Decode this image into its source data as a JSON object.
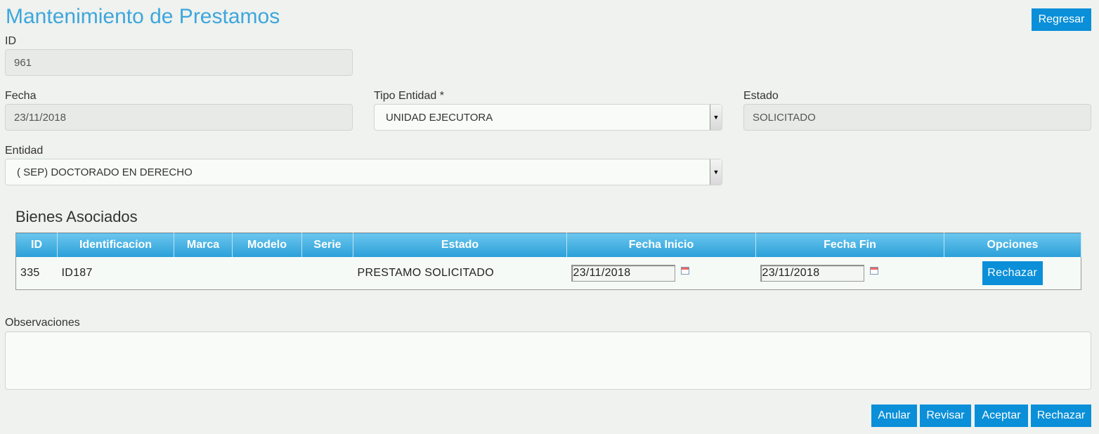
{
  "header": {
    "title": "Mantenimiento de Prestamos",
    "back_button": "Regresar"
  },
  "form": {
    "id": {
      "label": "ID",
      "value": "961"
    },
    "fecha": {
      "label": "Fecha",
      "value": "23/11/2018"
    },
    "tipo_entidad": {
      "label": "Tipo Entidad *",
      "value": "UNIDAD EJECUTORA"
    },
    "estado": {
      "label": "Estado",
      "value": "SOLICITADO"
    },
    "entidad": {
      "label": "Entidad",
      "value": "( SEP) DOCTORADO EN DERECHO"
    }
  },
  "bienes": {
    "title": "Bienes Asociados",
    "columns": [
      "ID",
      "Identificacion",
      "Marca",
      "Modelo",
      "Serie",
      "Estado",
      "Fecha Inicio",
      "Fecha Fin",
      "Opciones"
    ],
    "rows": [
      {
        "id": "335",
        "identificacion": "ID187",
        "marca": "",
        "modelo": "",
        "serie": "",
        "estado": "PRESTAMO SOLICITADO",
        "fecha_inicio": "23/11/2018",
        "fecha_fin": "23/11/2018",
        "action": "Rechazar"
      }
    ]
  },
  "observaciones": {
    "label": "Observaciones",
    "value": ""
  },
  "footer": {
    "anular": "Anular",
    "revisar": "Revisar",
    "aceptar": "Aceptar",
    "rechazar": "Rechazar"
  },
  "colors": {
    "accent": "#0a8fd8",
    "title": "#3ea6dc",
    "background": "#eff2ef"
  }
}
